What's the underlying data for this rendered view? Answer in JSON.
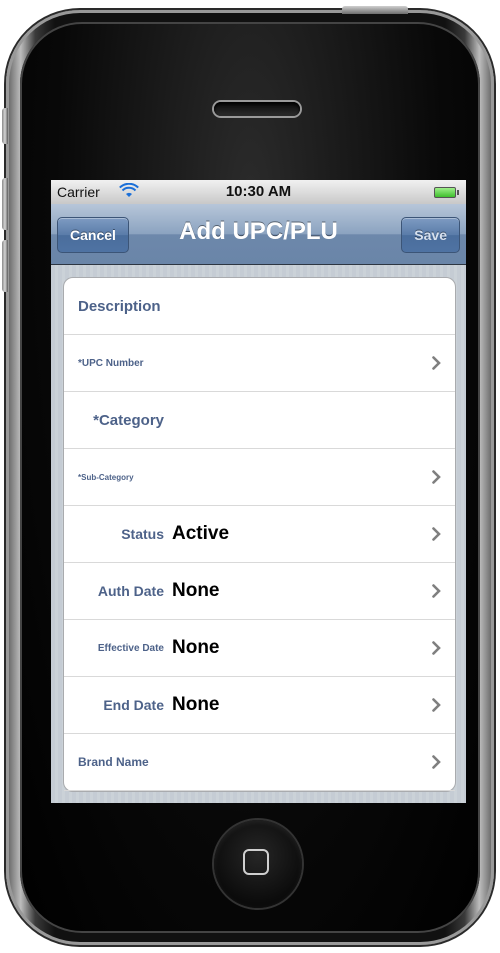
{
  "status_bar": {
    "carrier": "Carrier",
    "time": "10:30 AM",
    "wifi_icon": "wifi-icon",
    "battery_icon": "battery-icon"
  },
  "nav_bar": {
    "cancel_label": "Cancel",
    "title": "Add UPC/PLU",
    "save_label": "Save"
  },
  "form": {
    "rows": [
      {
        "label": "Description",
        "value": "",
        "chevron": false
      },
      {
        "label": "*UPC Number",
        "value": "",
        "chevron": true
      },
      {
        "label": "*Category",
        "value": "",
        "chevron": false
      },
      {
        "label": "*Sub-Category",
        "value": "",
        "chevron": true
      },
      {
        "label": "Status",
        "value": "Active",
        "chevron": true
      },
      {
        "label": "Auth Date",
        "value": "None",
        "chevron": true
      },
      {
        "label": "Effective Date",
        "value": "None",
        "chevron": true
      },
      {
        "label": "End Date",
        "value": "None",
        "chevron": true
      },
      {
        "label": "Brand Name",
        "value": "",
        "chevron": true
      }
    ]
  },
  "colors": {
    "label_blue": "#4d6289",
    "nav_blue": "#6d88ab",
    "table_background": "#c5ccd4"
  }
}
